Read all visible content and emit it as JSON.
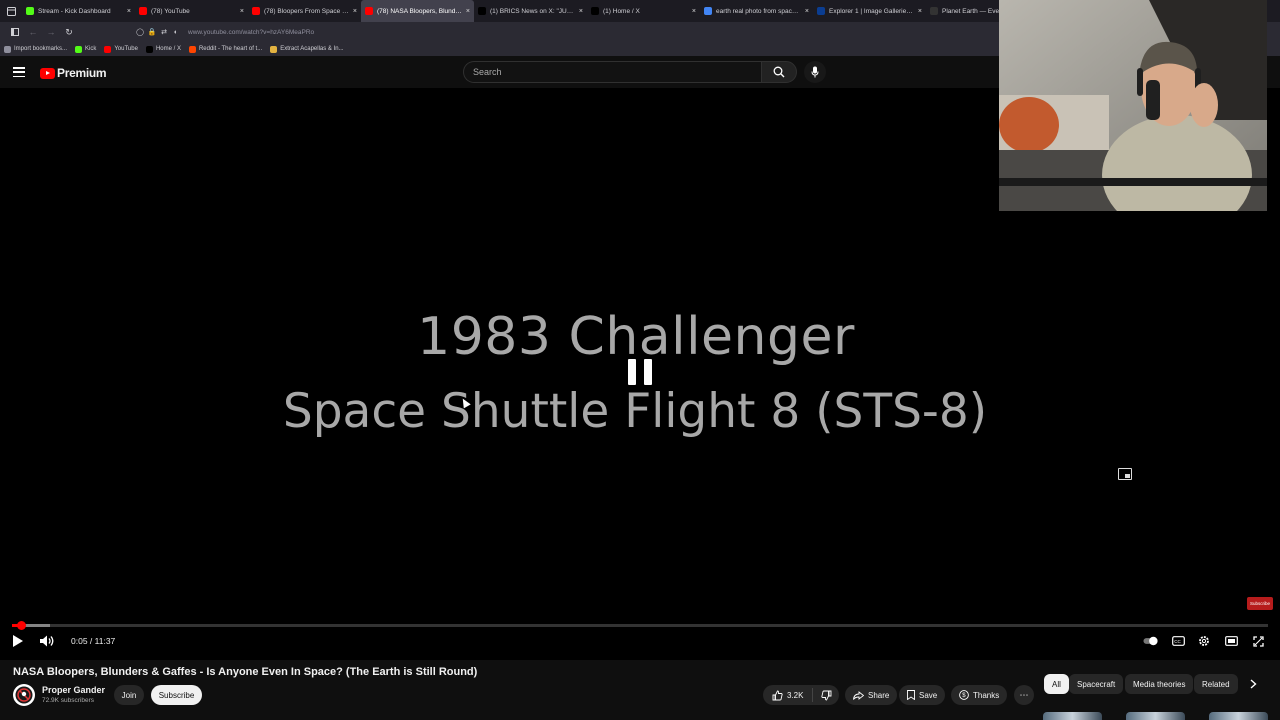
{
  "browser": {
    "tabs": [
      {
        "label": "Stream - Kick Dashboard",
        "icon": "kick-icon",
        "color": "#53fc18",
        "active": false
      },
      {
        "label": "(78) YouTube",
        "icon": "youtube-icon",
        "color": "#ff0000",
        "active": false
      },
      {
        "label": "(78) Bloopers From Space My T...",
        "icon": "youtube-icon",
        "color": "#ff0000",
        "active": false
      },
      {
        "label": "(78) NASA Bloopers, Blunders & G...",
        "icon": "youtube-icon",
        "color": "#ff0000",
        "active": true
      },
      {
        "label": "(1) BRICS News on X: \"JUST IN:...",
        "icon": "x-icon",
        "color": "#000000",
        "active": false
      },
      {
        "label": "(1) Home / X",
        "icon": "x-icon",
        "color": "#000000",
        "active": false
      },
      {
        "label": "earth real photo from space - G...",
        "icon": "google-icon",
        "color": "#4285f4",
        "active": false
      },
      {
        "label": "Explorer 1 | Image Galleries | In...",
        "icon": "nasa-icon",
        "color": "#0b3d91",
        "active": false
      },
      {
        "label": "Planet Earth — Everythi...",
        "icon": "s-icon",
        "color": "#333333",
        "active": false
      }
    ],
    "url": "www.youtube.com/watch?v=hzAY6MeaPRo",
    "bookmarks": [
      {
        "label": "Import bookmarks...",
        "icon": "import-icon",
        "color": "#8f8f9d"
      },
      {
        "label": "Kick",
        "icon": "kick-icon",
        "color": "#53fc18"
      },
      {
        "label": "YouTube",
        "icon": "youtube-icon",
        "color": "#ff0000"
      },
      {
        "label": "Home / X",
        "icon": "x-icon",
        "color": "#000000"
      },
      {
        "label": "Reddit - The heart of t...",
        "icon": "reddit-icon",
        "color": "#ff4500"
      },
      {
        "label": "Extract Acapellas & In...",
        "icon": "folder-icon",
        "color": "#e3b341"
      }
    ]
  },
  "youtube": {
    "brand": "Premium",
    "search_placeholder": "Search"
  },
  "video": {
    "overlay_line1": "1983 Challenger",
    "overlay_line2": "Space Shuttle Flight 8 (STS-8)",
    "time_current": "0:05",
    "time_total": "11:37",
    "progress_fraction": 0.007,
    "buffered_fraction": 0.03,
    "watermark": "Subscribe",
    "title": "NASA Bloopers, Blunders & Gaffes - Is Anyone Even In Space? (The Earth is Still Round)"
  },
  "channel": {
    "name": "Proper Gander",
    "subscribers": "72.9K subscribers",
    "join_label": "Join",
    "subscribe_label": "Subscribe"
  },
  "actions": {
    "likes": "3.2K",
    "share": "Share",
    "save": "Save",
    "thanks": "Thanks"
  },
  "chips": [
    "All",
    "Spacecraft",
    "Media theories",
    "Related"
  ]
}
